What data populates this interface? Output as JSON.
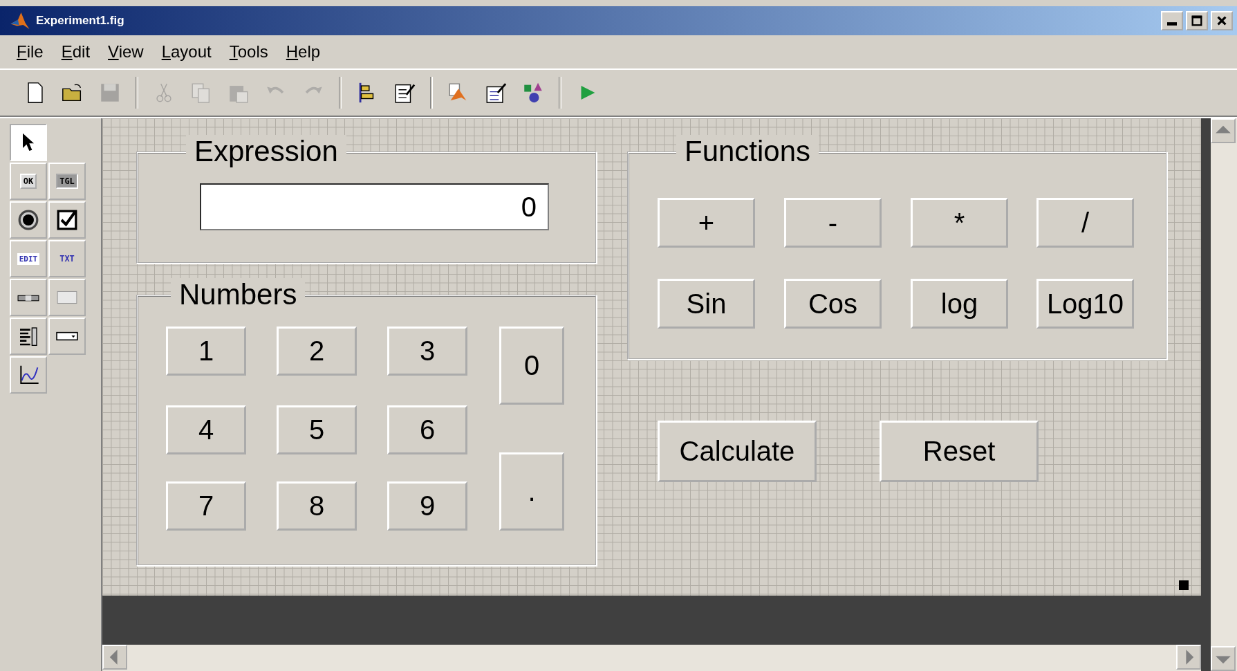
{
  "window": {
    "title": "Experiment1.fig"
  },
  "menu": [
    "File",
    "Edit",
    "View",
    "Layout",
    "Tools",
    "Help"
  ],
  "toolbar": [
    {
      "kind": "new",
      "disabled": false
    },
    {
      "kind": "open",
      "disabled": false
    },
    {
      "kind": "save",
      "disabled": true
    },
    {
      "kind": "sep"
    },
    {
      "kind": "cut",
      "disabled": true
    },
    {
      "kind": "copy",
      "disabled": true
    },
    {
      "kind": "paste",
      "disabled": true
    },
    {
      "kind": "undo",
      "disabled": true
    },
    {
      "kind": "redo",
      "disabled": true
    },
    {
      "kind": "sep"
    },
    {
      "kind": "align",
      "disabled": false
    },
    {
      "kind": "menu-editor",
      "disabled": false
    },
    {
      "kind": "sep"
    },
    {
      "kind": "editor",
      "disabled": false
    },
    {
      "kind": "inspector",
      "disabled": false
    },
    {
      "kind": "browser",
      "disabled": false
    },
    {
      "kind": "sep"
    },
    {
      "kind": "run",
      "disabled": false
    }
  ],
  "palette": [
    {
      "kind": "pointer",
      "selected": true
    },
    {
      "kind": "push",
      "label": "OK",
      "selected": false
    },
    {
      "kind": "toggle",
      "label": "TGL",
      "selected": false
    },
    {
      "kind": "radio",
      "selected": false
    },
    {
      "kind": "check",
      "selected": false
    },
    {
      "kind": "edit",
      "label": "EDIT",
      "selected": false
    },
    {
      "kind": "text",
      "label": "TXT",
      "selected": false
    },
    {
      "kind": "slider",
      "selected": false
    },
    {
      "kind": "frame",
      "selected": false
    },
    {
      "kind": "listbox",
      "selected": false
    },
    {
      "kind": "popup",
      "selected": false
    },
    {
      "kind": "axes",
      "selected": false
    }
  ],
  "expression": {
    "title": "Expression",
    "value": "0"
  },
  "numbers": {
    "title": "Numbers",
    "buttons": [
      "1",
      "2",
      "3",
      "0",
      "4",
      "5",
      "6",
      "7",
      "8",
      "9",
      "."
    ]
  },
  "functions": {
    "title": "Functions",
    "buttons": [
      "+",
      "-",
      "*",
      "/",
      "Sin",
      "Cos",
      "log",
      "Log10"
    ]
  },
  "actions": [
    "Calculate",
    "Reset"
  ]
}
